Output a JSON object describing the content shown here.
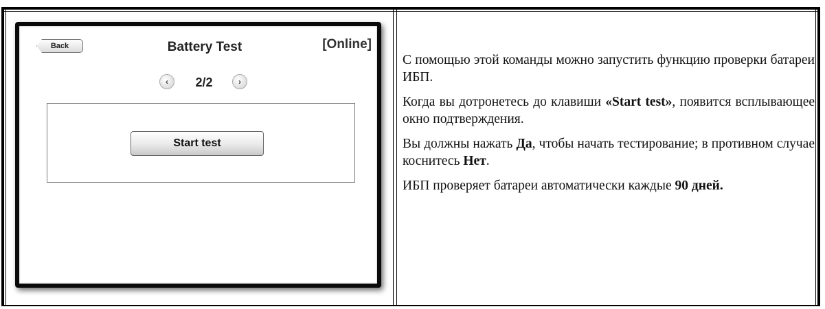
{
  "device": {
    "back_label": "Back",
    "title": "Battery Test",
    "status": "[Online]",
    "pager": {
      "prev_icon": "chevron-left-icon",
      "label": "2/2",
      "next_icon": "chevron-right-icon"
    },
    "start_button": "Start test"
  },
  "description": {
    "p1": "С помощью этой команды можно запустить функцию проверки батареи ИБП.",
    "p2_before": "Когда вы дотронетесь до клавиши ",
    "p2_bold": "«Start test»",
    "p2_after": ", появится всплывающее окно подтверждения.",
    "p3_a": "Вы должны нажать ",
    "p3_yes": "Да",
    "p3_b": ", чтобы начать тестирование; в противном случае коснитесь ",
    "p3_no": "Нет",
    "p3_c": ".",
    "p4_a": "ИБП проверяет батареи автоматически каждые ",
    "p4_bold": "90 дней."
  }
}
